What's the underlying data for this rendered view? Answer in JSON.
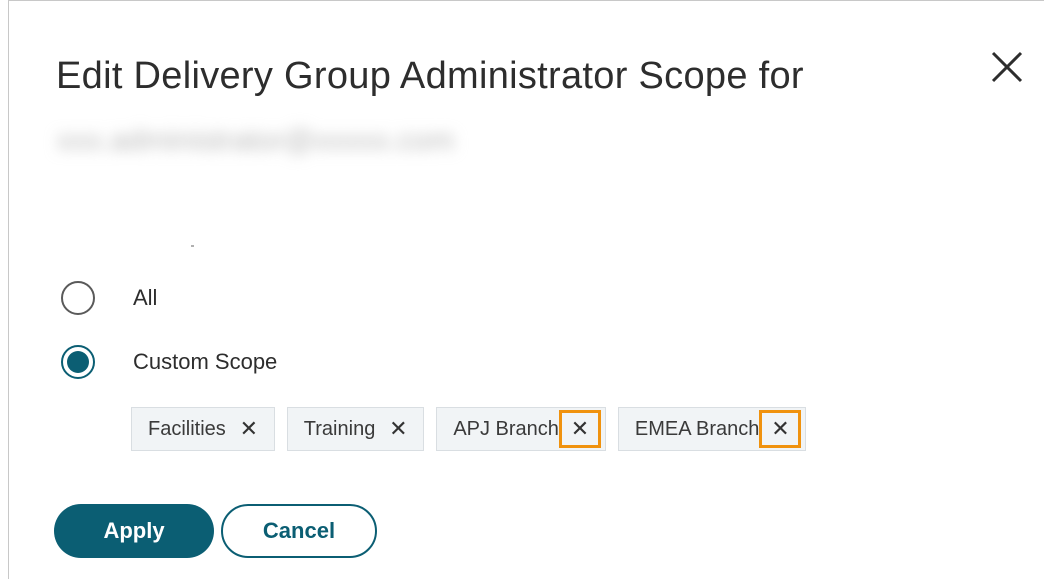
{
  "dialog": {
    "title": "Edit Delivery Group Administrator Scope for",
    "subject": "xxx.administrator@xxxxx.com"
  },
  "scope_options": [
    {
      "label": "All",
      "selected": false
    },
    {
      "label": "Custom Scope",
      "selected": true
    }
  ],
  "chips": [
    {
      "label": "Facilities",
      "remove": "✕",
      "highlighted": false
    },
    {
      "label": "Training",
      "remove": "✕",
      "highlighted": false
    },
    {
      "label": "APJ Branch",
      "remove": "✕",
      "highlighted": true
    },
    {
      "label": "EMEA Branch",
      "remove": "✕",
      "highlighted": true
    }
  ],
  "actions": {
    "apply": "Apply",
    "cancel": "Cancel"
  },
  "colors": {
    "accent": "#0b5e73",
    "highlight": "#f0920e",
    "chip_bg": "#f1f4f6"
  }
}
